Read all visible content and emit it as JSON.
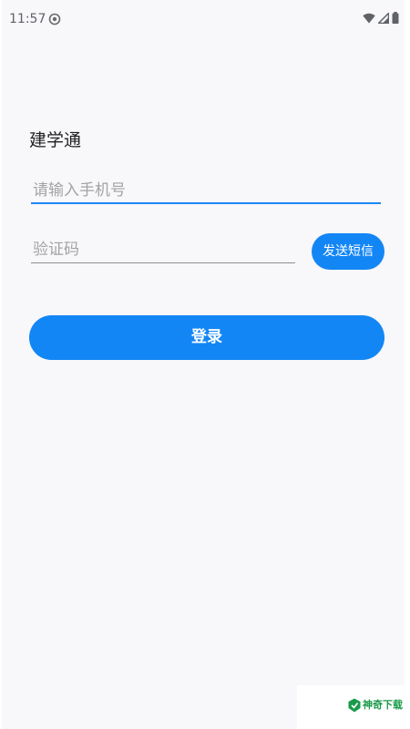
{
  "status_bar": {
    "time": "11:57",
    "icons": [
      "sync-icon",
      "wifi-icon",
      "cellular-signal-icon",
      "battery-icon"
    ]
  },
  "login": {
    "app_title": "建学通",
    "phone_placeholder": "请输入手机号",
    "phone_value": "",
    "code_placeholder": "验证码",
    "code_value": "",
    "send_sms_label": "发送短信",
    "login_label": "登录"
  },
  "watermark": {
    "text": "神奇下载"
  },
  "colors": {
    "accent": "#1386f5",
    "active_underline": "#1e88f5",
    "background": "#f8f7fa",
    "placeholder": "#a3a3a3",
    "watermark": "#1a9a4a"
  }
}
